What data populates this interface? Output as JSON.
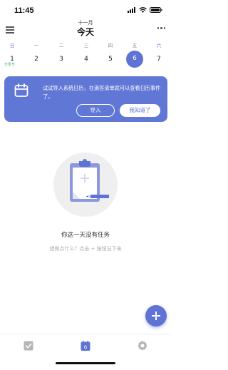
{
  "status": {
    "time": "11:45",
    "icons": [
      "signal-icon",
      "wifi-icon",
      "battery-icon"
    ]
  },
  "header": {
    "month": "十一月",
    "title": "今天",
    "menu_icon": "hamburger-menu-icon",
    "more_icon": "more-dots-icon"
  },
  "week": {
    "days": [
      {
        "label": "日",
        "date": "1"
      },
      {
        "label": "一",
        "date": "2"
      },
      {
        "label": "二",
        "date": "3"
      },
      {
        "label": "三",
        "date": "4"
      },
      {
        "label": "四",
        "date": "5"
      },
      {
        "label": "五",
        "date": "6"
      },
      {
        "label": "六",
        "date": "7"
      }
    ],
    "selected_date": "6",
    "festival": "万圣节"
  },
  "banner": {
    "icon": "calendar-icon",
    "text": "试试导入系统日历，在滴答清单就可以查看日历事件了。",
    "import_label": "导入",
    "dismiss_label": "我知道了"
  },
  "empty": {
    "illustration": "clipboard-pencil-icon",
    "title": "你这一天没有任务",
    "hint": "想做点什么？点击 + 按钮记下来"
  },
  "fab": {
    "icon": "plus-icon"
  },
  "nav": {
    "items": [
      {
        "name": "tasks",
        "icon": "checkbox-icon"
      },
      {
        "name": "calendar",
        "icon": "calendar-icon",
        "date": "6",
        "active": true
      },
      {
        "name": "settings",
        "icon": "gear-icon"
      }
    ]
  },
  "colors": {
    "accent": "#5f73d4",
    "festival": "#3cb371",
    "weekday_blue": "#5b73d9"
  }
}
